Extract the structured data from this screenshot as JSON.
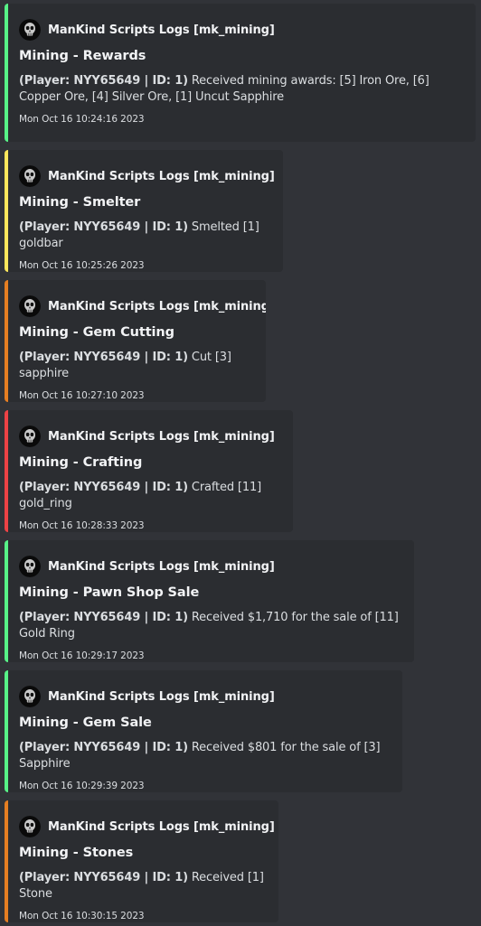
{
  "app": {
    "bot_name": "ManKind Scripts Logs [mk_mining]",
    "avatar_icon": "skull-avatar-icon"
  },
  "colors": {
    "background": "#313338",
    "embed_background": "#2b2d31",
    "green": "#57f287",
    "yellow": "#fee75c",
    "orange": "#e67e22",
    "red": "#ed4245"
  },
  "messages": [
    {
      "author": "ManKind Scripts Logs [mk_mining]",
      "title": "Mining - Rewards",
      "prefix": "(Player: NYY65649 | ID: 1)",
      "text": " Received mining awards: [5] Iron Ore, [6] Copper Ore, [4] Silver Ore, [1] Uncut Sapphire",
      "timestamp": "Mon Oct 16 10:24:16 2023",
      "accent": "#57f287"
    },
    {
      "author": "ManKind Scripts Logs [mk_mining]",
      "title": "Mining - Smelter",
      "prefix": "(Player: NYY65649 | ID: 1)",
      "text": " Smelted [1] goldbar",
      "timestamp": "Mon Oct 16 10:25:26 2023",
      "accent": "#fee75c"
    },
    {
      "author": "ManKind Scripts Logs [mk_mining]",
      "title": "Mining - Gem Cutting",
      "prefix": "(Player: NYY65649 | ID: 1)",
      "text": " Cut [3] sapphire",
      "timestamp": "Mon Oct 16 10:27:10 2023",
      "accent": "#e67e22"
    },
    {
      "author": "ManKind Scripts Logs [mk_mining]",
      "title": "Mining - Crafting",
      "prefix": "(Player: NYY65649 | ID: 1)",
      "text": " Crafted [11] gold_ring",
      "timestamp": "Mon Oct 16 10:28:33 2023",
      "accent": "#ed4245"
    },
    {
      "author": "ManKind Scripts Logs [mk_mining]",
      "title": "Mining - Pawn Shop Sale",
      "prefix": "(Player: NYY65649 | ID: 1)",
      "text": " Received $1,710 for the sale of [11] Gold Ring",
      "timestamp": "Mon Oct 16 10:29:17 2023",
      "accent": "#57f287"
    },
    {
      "author": "ManKind Scripts Logs [mk_mining]",
      "title": "Mining - Gem Sale",
      "prefix": "(Player: NYY65649 | ID: 1)",
      "text": " Received $801 for the sale of [3] Sapphire",
      "timestamp": "Mon Oct 16 10:29:39 2023",
      "accent": "#57f287"
    },
    {
      "author": "ManKind Scripts Logs [mk_mining]",
      "title": "Mining - Stones",
      "prefix": "(Player: NYY65649 | ID: 1)",
      "text": " Received [1] Stone",
      "timestamp": "Mon Oct 16 10:30:15 2023",
      "accent": "#e67e22"
    }
  ]
}
